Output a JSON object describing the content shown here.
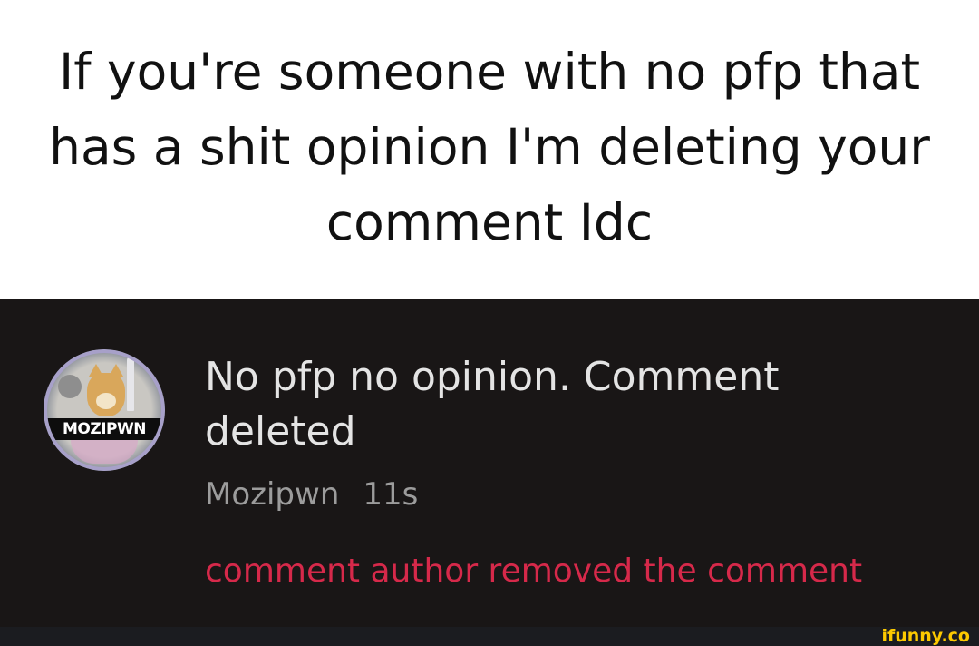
{
  "caption": {
    "text": "If you're someone with no pfp that has a shit opinion I'm deleting your comment Idc"
  },
  "comment": {
    "avatar_label": "MOZIPWN",
    "body": "No pfp no opinion. Comment deleted",
    "author": "Mozipwn",
    "time": "11s",
    "removed_notice": "comment author removed the comment"
  },
  "watermark": {
    "text": "ifunny.co",
    "color": "#fcc900"
  },
  "colors": {
    "dark_background": "#191616",
    "removed_text": "#d6294a"
  }
}
